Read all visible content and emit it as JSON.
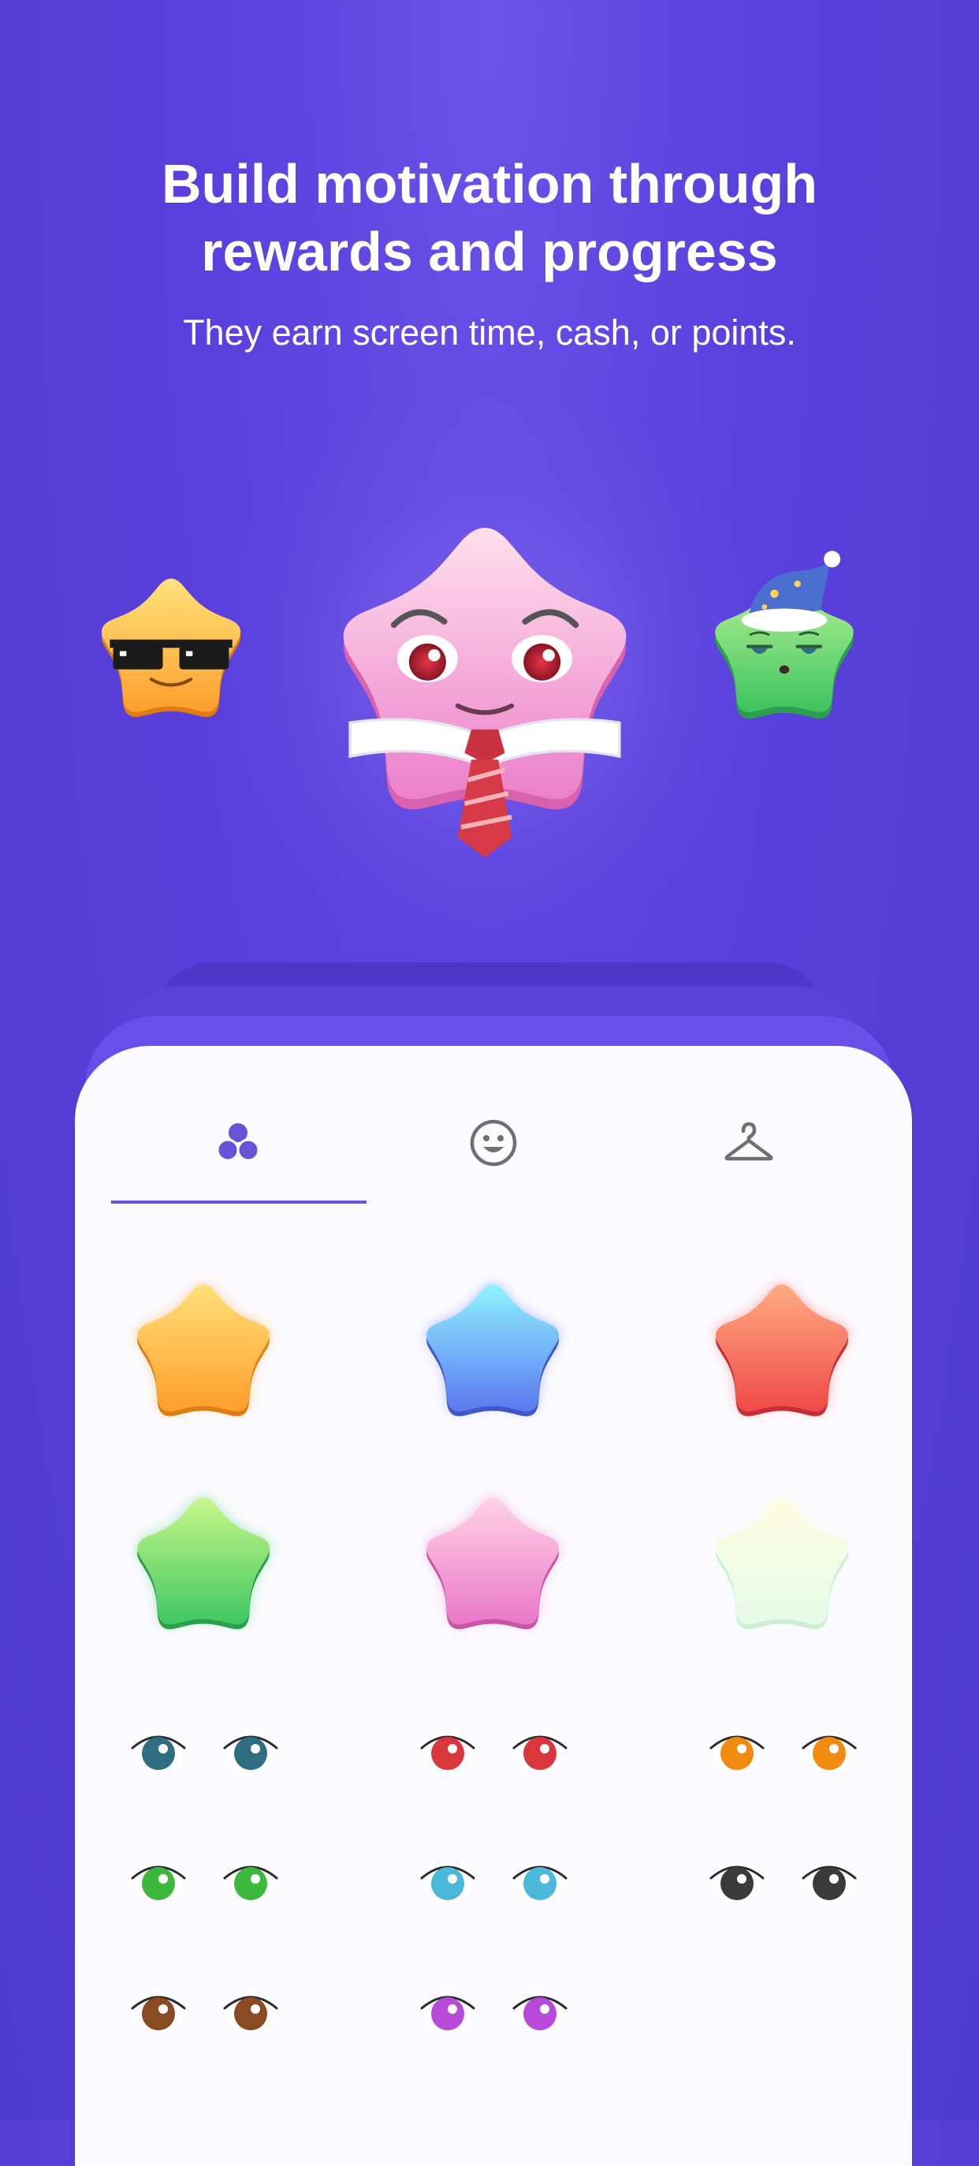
{
  "header": {
    "title": "Build motivation through\nrewards and progress",
    "subtitle": "They earn screen time, cash, or points."
  },
  "hero": {
    "characters": [
      {
        "name": "yellow-star-sunglasses",
        "color": "#ffb53a"
      },
      {
        "name": "pink-star-tie",
        "color": "#f39ad2"
      },
      {
        "name": "green-star-nightcap",
        "color": "#5fcf6a"
      }
    ]
  },
  "customizer": {
    "tabs": [
      {
        "name": "colors",
        "icon": "color-circles-icon",
        "selected": true
      },
      {
        "name": "faces",
        "icon": "smiley-face-icon",
        "selected": false
      },
      {
        "name": "outfits",
        "icon": "hanger-icon",
        "selected": false
      }
    ],
    "accent": "#6a52d6",
    "star_colors": [
      {
        "name": "yellow",
        "top": "#ffe07a",
        "bottom": "#ff9e2c",
        "shadow": "#e07d12"
      },
      {
        "name": "blue",
        "top": "#8ff3ff",
        "bottom": "#5b78f0",
        "shadow": "#4057c8"
      },
      {
        "name": "red",
        "top": "#ffab82",
        "bottom": "#ef4a48",
        "shadow": "#c52e36"
      },
      {
        "name": "green",
        "top": "#c9f78a",
        "bottom": "#3fc862",
        "shadow": "#2c9e4e"
      },
      {
        "name": "pink",
        "top": "#ffd3e6",
        "bottom": "#ea78c8",
        "shadow": "#c855a6"
      },
      {
        "name": "pale-yellow",
        "top": "#fffde0",
        "bottom": "#e6fbe9",
        "shadow": "#cdeed6"
      }
    ],
    "eye_colors": [
      {
        "name": "teal",
        "iris": "#2f6e82"
      },
      {
        "name": "red",
        "iris": "#d9363e"
      },
      {
        "name": "orange",
        "iris": "#f08a10"
      },
      {
        "name": "green",
        "iris": "#3cb83c"
      },
      {
        "name": "light-blue",
        "iris": "#4ab8d8"
      },
      {
        "name": "black",
        "iris": "#3a3a3a"
      },
      {
        "name": "brown",
        "iris": "#8a4a22"
      },
      {
        "name": "purple",
        "iris": "#b84ad8"
      }
    ]
  }
}
